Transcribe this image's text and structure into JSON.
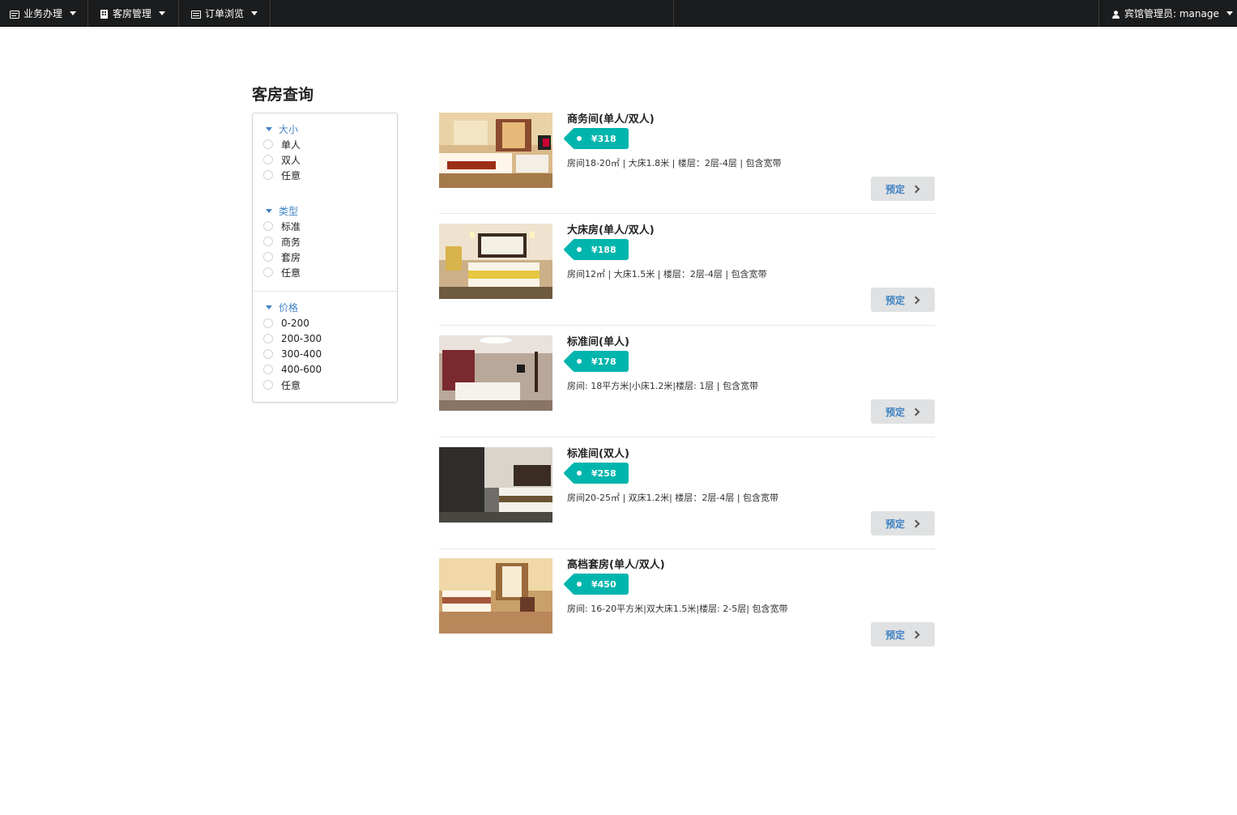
{
  "nav": {
    "menus": [
      {
        "label": "业务办理",
        "icon": "id-card-icon"
      },
      {
        "label": "客房管理",
        "icon": "building-icon"
      },
      {
        "label": "订单浏览",
        "icon": "list-icon"
      }
    ],
    "user": {
      "label": "宾馆管理员: manage",
      "icon": "user-icon"
    }
  },
  "page": {
    "title": "客房查询"
  },
  "filters": {
    "size": {
      "title": "大小",
      "options": [
        "单人",
        "双人",
        "任意"
      ]
    },
    "type": {
      "title": "类型",
      "options": [
        "标准",
        "商务",
        "套房",
        "任意"
      ]
    },
    "price": {
      "title": "价格",
      "options": [
        "0-200",
        "200-300",
        "300-400",
        "400-600",
        "任意"
      ]
    }
  },
  "colors": {
    "accent": "#00b5ad",
    "link": "#4183c4",
    "navbar": "#1b1c1d"
  },
  "rooms": [
    {
      "name": "商务间(单人/双人)",
      "price": "¥318",
      "desc": "房间18-20㎡ | 大床1.8米 | 楼层：2层-4层 | 包含宽带",
      "button": "预定"
    },
    {
      "name": "大床房(单人/双人)",
      "price": "¥188",
      "desc": "房间12㎡ | 大床1.5米 | 楼层：2层-4层 | 包含宽带",
      "button": "预定"
    },
    {
      "name": "标准间(单人)",
      "price": "¥178",
      "desc": "房间: 18平方米|小床1.2米|楼层: 1层 | 包含宽带",
      "button": "预定"
    },
    {
      "name": "标准间(双人)",
      "price": "¥258",
      "desc": "房间20-25㎡ | 双床1.2米| 楼层：2层-4层 | 包含宽带",
      "button": "预定"
    },
    {
      "name": "高档套房(单人/双人)",
      "price": "¥450",
      "desc": "房间: 16-20平方米|双大床1.5米|楼层: 2-5层| 包含宽带",
      "button": "预定"
    }
  ]
}
